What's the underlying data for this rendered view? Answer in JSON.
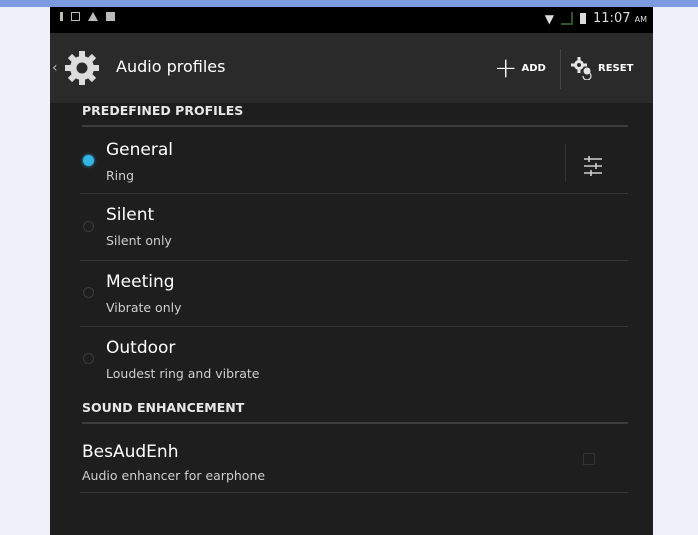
{
  "status_bar": {
    "time": "11:07",
    "ampm": "AM"
  },
  "action_bar": {
    "title": "Audio profiles",
    "add_label": "ADD",
    "reset_label": "RESET",
    "icon": "gear-icon"
  },
  "sections": {
    "predefined": {
      "header": "PREDEFINED PROFILES",
      "items": [
        {
          "title": "General",
          "subtitle": "Ring",
          "selected": true
        },
        {
          "title": "Silent",
          "subtitle": "Silent only",
          "selected": false
        },
        {
          "title": "Meeting",
          "subtitle": "Vibrate only",
          "selected": false
        },
        {
          "title": "Outdoor",
          "subtitle": "Loudest ring and vibrate",
          "selected": false
        }
      ]
    },
    "sound_enhancement": {
      "header": "SOUND ENHANCEMENT",
      "item": {
        "title": "BesAudEnh",
        "subtitle": "Audio enhancer for earphone",
        "checked": false
      }
    }
  },
  "colors": {
    "accent": "#33b5e5",
    "background": "#1e1e1e",
    "action_bar": "#2a2a2a"
  }
}
